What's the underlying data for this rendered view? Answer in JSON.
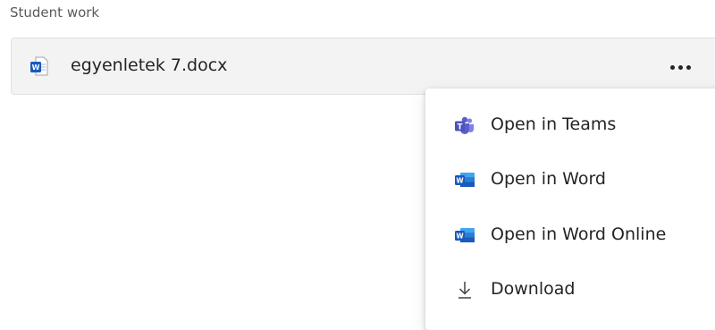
{
  "section": {
    "label": "Student work"
  },
  "file": {
    "name": "egyenletek 7.docx",
    "icon": "word-doc-icon"
  },
  "more_button": {
    "icon": "more-horizontal-icon"
  },
  "menu": {
    "items": [
      {
        "label": "Open in Teams",
        "icon": "teams-icon"
      },
      {
        "label": "Open in Word",
        "icon": "word-icon"
      },
      {
        "label": "Open in Word Online",
        "icon": "word-icon"
      },
      {
        "label": "Download",
        "icon": "download-icon"
      }
    ]
  },
  "colors": {
    "word_blue": "#185abd",
    "teams_purple": "#5b5fc7",
    "card_background": "#f3f3f3"
  }
}
